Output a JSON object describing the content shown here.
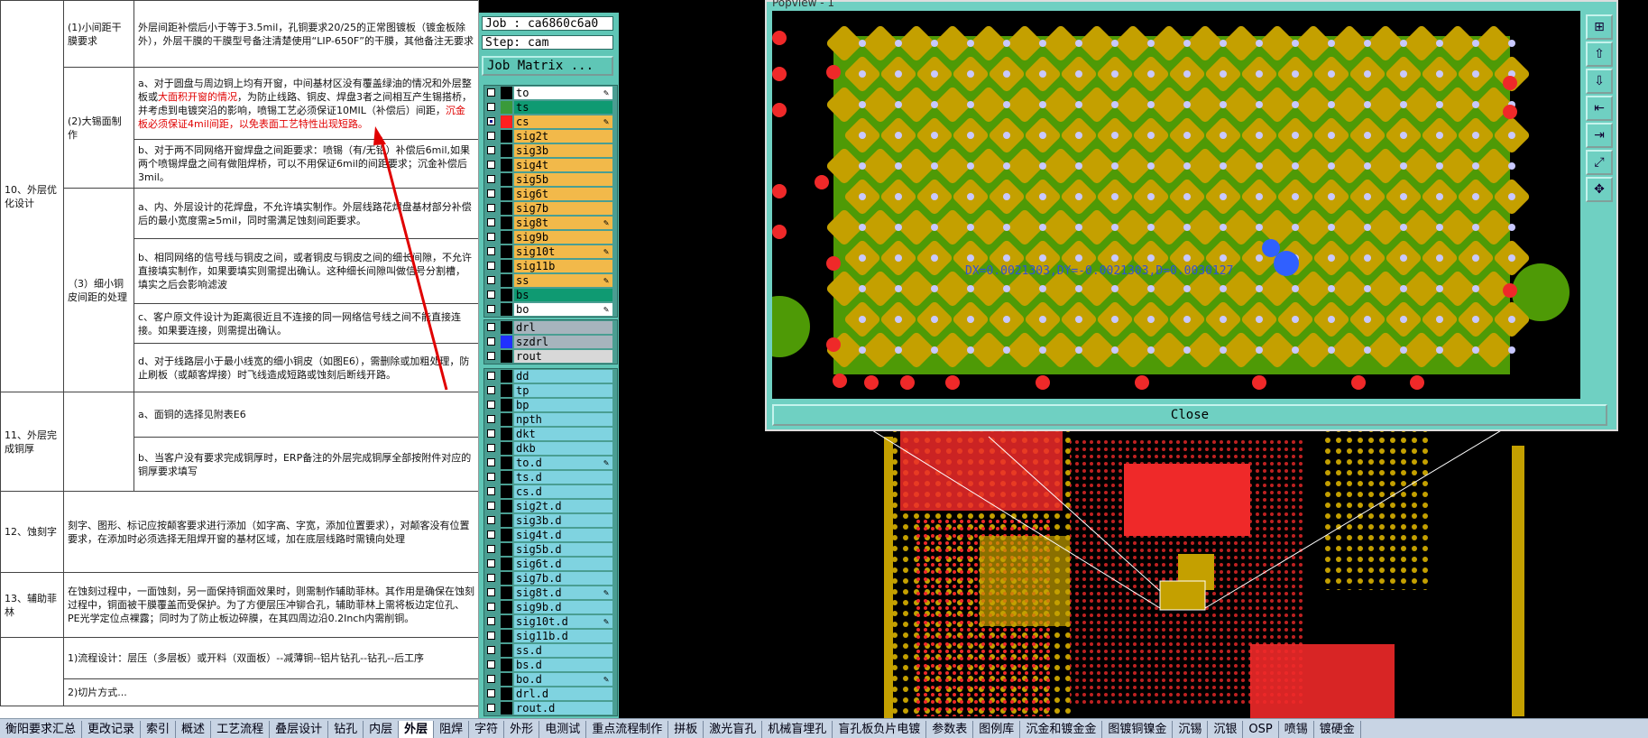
{
  "document": {
    "rows": [
      {
        "category": "10、外层优化设计",
        "sub": "(1)小间距干膜要求",
        "text": "外层间距补偿后小于等于3.5mil，孔铜要求20/25的正常图镀板（镀金板除外），外层干膜的干膜型号备注清楚使用“LIP-650F”的干膜，其他备注无要求"
      },
      {
        "sub": "(2)大锡面制作",
        "parts": [
          {
            "t": "a、对于圆盘与周边铜上均有开窗，中间基材区没有覆盖绿油的情况和外层整板或",
            "red": false
          },
          {
            "t": "大面积开窗的情况",
            "red": true
          },
          {
            "t": "，为防止线路、铜皮、焊盘3者之间相互产生锡搭桥，并考虑到电镀突沿的影响，喷锡工艺必须保证10MIL（补偿后）间距，",
            "red": false
          },
          {
            "t": "沉金板必须保证4mil间距，以免表面工艺特性出现短路。",
            "red": true
          }
        ]
      },
      {
        "text": "b、对于两不同网络开窗焊盘之间距要求：喷锡（有/无铅）补偿后6mil,如果两个喷锡焊盘之间有做阻焊桥，可以不用保证6mil的间距要求；沉金补偿后3mil。"
      },
      {
        "sub": "（3）细小铜皮间距的处理",
        "text": "a、内、外层设计的花焊盘，不允许填实制作。外层线路花焊盘基材部分补偿后的最小宽度需≥5mil，同时需满足蚀刻间距要求。"
      },
      {
        "text": "b、相同网络的信号线与铜皮之间，或者铜皮与铜皮之间的细长间隙，不允许直接填实制作，如果要填实则需提出确认。这种细长间隙叫做信号分割槽，填实之后会影响滤波"
      },
      {
        "text": "c、客户原文件设计为距离很近且不连接的同一网络信号线之间不能直接连接。如果要连接，则需提出确认。"
      },
      {
        "text": "d、对于线路层小于最小线宽的细小铜皮（如图E6），需删除或加粗处理，防止刷板（或颠客焊接）时飞线造成短路或蚀刻后断线开路。"
      },
      {
        "category": "11、外层完成铜厚",
        "text": "a、面铜的选择见附表E6"
      },
      {
        "text": "b、当客户没有要求完成铜厚时，ERP备注的外层完成铜厚全部按附件对应的铜厚要求填写"
      },
      {
        "category": "12、蚀刻字",
        "text": "刻字、图形、标记应按颠客要求进行添加（如字高、字宽，添加位置要求），对颠客没有位置要求，在添加时必须选择无阻焊开窗的基材区域，加在底层线路时需镜向处理"
      },
      {
        "category": "13、辅助菲林",
        "text": "在蚀刻过程中，一面蚀刻，另一面保持铜面效果时，则需制作辅助菲林。其作用是确保在蚀刻过程中，铜面被干膜覆盖而受保护。为了方便层压冲铆合孔，辅助菲林上需将板边定位孔、PE光学定位点裸露；同时为了防止板边碎膜，在其四周边沿0.2Inch内需削铜。"
      },
      {
        "text": "1)流程设计：层压（多层板）或开料（双面板）--减薄铜--铝片钻孔--钻孔--后工序"
      },
      {
        "text": "2)切片方式..."
      }
    ]
  },
  "cam": {
    "job_label": "Job : ca6860c6a0",
    "step_label": "Step: cam",
    "matrix_button": "Job Matrix ...",
    "group1": [
      {
        "name": "to",
        "color": "#ffffff",
        "sw": "#000000",
        "edit": "✎"
      },
      {
        "name": "ts",
        "color": "#0f9a72",
        "sw": "#3a9a3a",
        "edit": ""
      },
      {
        "name": "cs",
        "color": "#f2b94a",
        "sw": "#ff2020",
        "edit": "✎",
        "active": true
      },
      {
        "name": "sig2t",
        "color": "#f2b94a",
        "sw": "#000000",
        "edit": ""
      },
      {
        "name": "sig3b",
        "color": "#f2b94a",
        "sw": "#000000",
        "edit": ""
      },
      {
        "name": "sig4t",
        "color": "#f2b94a",
        "sw": "#000000",
        "edit": ""
      },
      {
        "name": "sig5b",
        "color": "#f2b94a",
        "sw": "#000000",
        "edit": ""
      },
      {
        "name": "sig6t",
        "color": "#f2b94a",
        "sw": "#000000",
        "edit": ""
      },
      {
        "name": "sig7b",
        "color": "#f2b94a",
        "sw": "#000000",
        "edit": ""
      },
      {
        "name": "sig8t",
        "color": "#f2b94a",
        "sw": "#000000",
        "edit": "✎"
      },
      {
        "name": "sig9b",
        "color": "#f2b94a",
        "sw": "#000000",
        "edit": ""
      },
      {
        "name": "sig10t",
        "color": "#f2b94a",
        "sw": "#000000",
        "edit": "✎"
      },
      {
        "name": "sig11b",
        "color": "#f2b94a",
        "sw": "#000000",
        "edit": ""
      },
      {
        "name": "ss",
        "color": "#f2b94a",
        "sw": "#000000",
        "edit": "✎"
      },
      {
        "name": "bs",
        "color": "#0f9a72",
        "sw": "#000000",
        "edit": ""
      },
      {
        "name": "bo",
        "color": "#ffffff",
        "sw": "#000000",
        "edit": "✎"
      }
    ],
    "group2": [
      {
        "name": "drl",
        "color": "#a7b4bd",
        "sw": "#000000",
        "edit": ""
      },
      {
        "name": "szdrl",
        "color": "#a7b4bd",
        "sw": "#2030ff",
        "edit": ""
      },
      {
        "name": "rout",
        "color": "#d8d8d8",
        "sw": "#000000",
        "edit": ""
      }
    ],
    "group3": [
      {
        "name": "dd",
        "color": "#7fd3e0",
        "sw": "#000000",
        "edit": ""
      },
      {
        "name": "tp",
        "color": "#7fd3e0",
        "sw": "#000000",
        "edit": ""
      },
      {
        "name": "bp",
        "color": "#7fd3e0",
        "sw": "#000000",
        "edit": ""
      },
      {
        "name": "npth",
        "color": "#7fd3e0",
        "sw": "#000000",
        "edit": ""
      },
      {
        "name": "dkt",
        "color": "#7fd3e0",
        "sw": "#000000",
        "edit": ""
      },
      {
        "name": "dkb",
        "color": "#7fd3e0",
        "sw": "#000000",
        "edit": ""
      },
      {
        "name": "to.d",
        "color": "#7fd3e0",
        "sw": "#000000",
        "edit": "✎"
      },
      {
        "name": "ts.d",
        "color": "#7fd3e0",
        "sw": "#000000",
        "edit": ""
      },
      {
        "name": "cs.d",
        "color": "#7fd3e0",
        "sw": "#000000",
        "edit": ""
      },
      {
        "name": "sig2t.d",
        "color": "#7fd3e0",
        "sw": "#000000",
        "edit": ""
      },
      {
        "name": "sig3b.d",
        "color": "#7fd3e0",
        "sw": "#000000",
        "edit": ""
      },
      {
        "name": "sig4t.d",
        "color": "#7fd3e0",
        "sw": "#000000",
        "edit": ""
      },
      {
        "name": "sig5b.d",
        "color": "#7fd3e0",
        "sw": "#000000",
        "edit": ""
      },
      {
        "name": "sig6t.d",
        "color": "#7fd3e0",
        "sw": "#000000",
        "edit": ""
      },
      {
        "name": "sig7b.d",
        "color": "#7fd3e0",
        "sw": "#000000",
        "edit": ""
      },
      {
        "name": "sig8t.d",
        "color": "#7fd3e0",
        "sw": "#000000",
        "edit": "✎"
      },
      {
        "name": "sig9b.d",
        "color": "#7fd3e0",
        "sw": "#000000",
        "edit": ""
      },
      {
        "name": "sig10t.d",
        "color": "#7fd3e0",
        "sw": "#000000",
        "edit": "✎"
      },
      {
        "name": "sig11b.d",
        "color": "#7fd3e0",
        "sw": "#000000",
        "edit": ""
      },
      {
        "name": "ss.d",
        "color": "#7fd3e0",
        "sw": "#000000",
        "edit": ""
      },
      {
        "name": "bs.d",
        "color": "#7fd3e0",
        "sw": "#000000",
        "edit": ""
      },
      {
        "name": "bo.d",
        "color": "#7fd3e0",
        "sw": "#000000",
        "edit": "✎"
      },
      {
        "name": "drl.d",
        "color": "#7fd3e0",
        "sw": "#000000",
        "edit": ""
      },
      {
        "name": "rout.d",
        "color": "#7fd3e0",
        "sw": "#000000",
        "edit": ""
      }
    ]
  },
  "popup": {
    "title": "Popview - 1",
    "measure": "DX=0.0021303,DY=-0.0021303,D=0.0030127",
    "close_label": "Close",
    "tools": [
      "zoom-icon",
      "layer-up-icon",
      "layer-down-icon",
      "pan-left-icon",
      "pan-right-icon",
      "fit-icon",
      "zoom-out-icon"
    ],
    "colors": {
      "board": "#4e9a06",
      "copper": "#c4a000",
      "pad": "#ef2929",
      "drill": "#c8c8ff",
      "marker": "#3060ff"
    }
  },
  "sheets": [
    "衡阳要求汇总",
    "更改记录",
    "索引",
    "概述",
    "工艺流程",
    "叠层设计",
    "钻孔",
    "内层",
    "外层",
    "阻焊",
    "字符",
    "外形",
    "电测试",
    "重点流程制作",
    "拼板",
    "激光盲孔",
    "机械盲埋孔",
    "盲孔板负片电镀",
    "参数表",
    "图例库",
    "沉金和镀金金",
    "图镀铜镍金",
    "沉锡",
    "沉银",
    "OSP",
    "喷锡",
    "镀硬金"
  ]
}
